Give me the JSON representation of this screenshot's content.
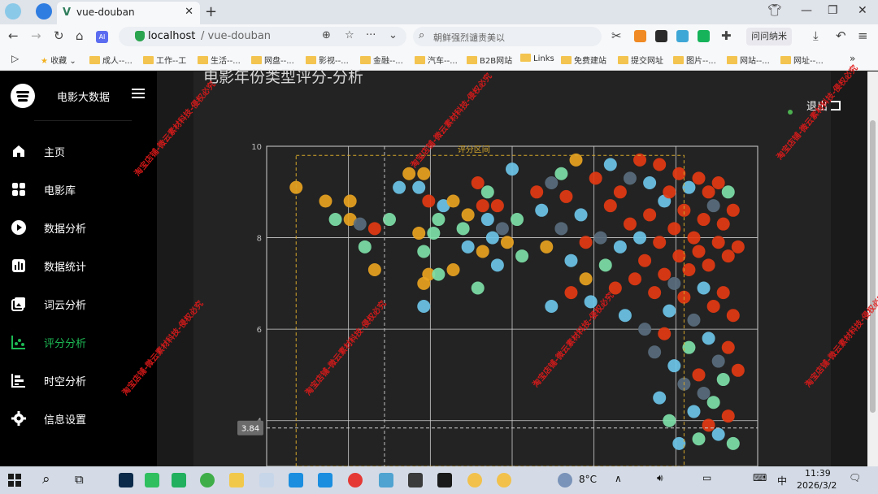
{
  "browser": {
    "tab_title": "vue-douban",
    "url_host": "localhost",
    "url_path": "/ vue-douban",
    "search_placeholder": "朝鲜强烈谴责美以",
    "ext_label": "问问纳米",
    "bookmarks": [
      "收藏",
      "成人--...",
      "工作--工",
      "生活--...",
      "网盘--...",
      "影视--...",
      "金融--...",
      "汽车--...",
      "B2B网站",
      "Links",
      "免费建站",
      "提交网址",
      "图片--...",
      "网站--...",
      "网址--..."
    ]
  },
  "app": {
    "brand": "电影大数据",
    "menu": [
      {
        "label": "主页",
        "icon": "home-icon"
      },
      {
        "label": "电影库",
        "icon": "grid-icon"
      },
      {
        "label": "数据分析",
        "icon": "play-circle-icon"
      },
      {
        "label": "数据统计",
        "icon": "bar-chart-icon"
      },
      {
        "label": "词云分析",
        "icon": "image-icon"
      },
      {
        "label": "评分分析",
        "icon": "scatter-icon",
        "active": true
      },
      {
        "label": "时空分析",
        "icon": "timeline-icon"
      },
      {
        "label": "信息设置",
        "icon": "gear-icon"
      }
    ],
    "page_title": "电影年份类型评分-分析",
    "logout": "退出",
    "accent": "#1db954"
  },
  "chart_data": {
    "type": "scatter",
    "ylim": [
      3,
      10
    ],
    "yticks": [
      "10",
      "8",
      "6",
      "4"
    ],
    "markarea_label": "评分区间",
    "markline_value": "3.84",
    "series_colors": [
      "#e8a321",
      "#6cc4e8",
      "#7ee0a8",
      "#f1a630",
      "#5a6e7e",
      "#e33a12"
    ],
    "points": [
      [
        0.06,
        9.1,
        0
      ],
      [
        0.12,
        8.8,
        0
      ],
      [
        0.17,
        8.8,
        0
      ],
      [
        0.14,
        8.4,
        2
      ],
      [
        0.17,
        8.4,
        0
      ],
      [
        0.19,
        8.3,
        4
      ],
      [
        0.22,
        8.2,
        5
      ],
      [
        0.25,
        8.4,
        2
      ],
      [
        0.2,
        7.8,
        2
      ],
      [
        0.22,
        7.3,
        0
      ],
      [
        0.27,
        9.1,
        1
      ],
      [
        0.29,
        9.4,
        0
      ],
      [
        0.31,
        9.1,
        1
      ],
      [
        0.32,
        9.4,
        0
      ],
      [
        0.33,
        8.8,
        5
      ],
      [
        0.34,
        8.1,
        2
      ],
      [
        0.35,
        8.4,
        2
      ],
      [
        0.31,
        8.1,
        0
      ],
      [
        0.32,
        7.7,
        2
      ],
      [
        0.33,
        7.2,
        0
      ],
      [
        0.32,
        7.0,
        0
      ],
      [
        0.35,
        7.2,
        2
      ],
      [
        0.36,
        8.7,
        1
      ],
      [
        0.38,
        8.8,
        0
      ],
      [
        0.38,
        7.3,
        0
      ],
      [
        0.32,
        6.5,
        1
      ],
      [
        0.4,
        8.2,
        2
      ],
      [
        0.41,
        8.5,
        0
      ],
      [
        0.41,
        7.8,
        1
      ],
      [
        0.43,
        9.2,
        5
      ],
      [
        0.44,
        8.7,
        5
      ],
      [
        0.45,
        8.4,
        1
      ],
      [
        0.47,
        8.7,
        5
      ],
      [
        0.45,
        9.0,
        2
      ],
      [
        0.44,
        7.7,
        0
      ],
      [
        0.46,
        8.0,
        1
      ],
      [
        0.47,
        7.4,
        1
      ],
      [
        0.48,
        8.2,
        4
      ],
      [
        0.49,
        7.9,
        0
      ],
      [
        0.5,
        9.5,
        1
      ],
      [
        0.51,
        8.4,
        2
      ],
      [
        0.52,
        7.6,
        2
      ],
      [
        0.43,
        6.9,
        2
      ],
      [
        0.55,
        9.0,
        5
      ],
      [
        0.56,
        8.6,
        1
      ],
      [
        0.58,
        9.2,
        4
      ],
      [
        0.57,
        7.8,
        0
      ],
      [
        0.58,
        6.5,
        1
      ],
      [
        0.6,
        9.4,
        2
      ],
      [
        0.61,
        8.9,
        5
      ],
      [
        0.6,
        8.2,
        4
      ],
      [
        0.62,
        7.5,
        1
      ],
      [
        0.62,
        6.8,
        5
      ],
      [
        0.63,
        9.7,
        0
      ],
      [
        0.64,
        8.5,
        1
      ],
      [
        0.65,
        7.9,
        5
      ],
      [
        0.65,
        7.1,
        0
      ],
      [
        0.66,
        6.6,
        1
      ],
      [
        0.67,
        9.3,
        5
      ],
      [
        0.68,
        8.0,
        4
      ],
      [
        0.69,
        7.4,
        2
      ],
      [
        0.7,
        9.6,
        1
      ],
      [
        0.7,
        8.7,
        5
      ],
      [
        0.71,
        6.9,
        5
      ],
      [
        0.72,
        9.0,
        5
      ],
      [
        0.72,
        7.8,
        1
      ],
      [
        0.73,
        6.3,
        1
      ],
      [
        0.74,
        9.3,
        4
      ],
      [
        0.74,
        8.3,
        5
      ],
      [
        0.75,
        7.1,
        5
      ],
      [
        0.76,
        9.7,
        5
      ],
      [
        0.76,
        8.0,
        1
      ],
      [
        0.77,
        6.0,
        4
      ],
      [
        0.77,
        7.5,
        5
      ],
      [
        0.78,
        9.2,
        1
      ],
      [
        0.78,
        8.5,
        5
      ],
      [
        0.79,
        6.8,
        5
      ],
      [
        0.79,
        5.5,
        4
      ],
      [
        0.8,
        9.6,
        5
      ],
      [
        0.8,
        7.9,
        5
      ],
      [
        0.8,
        4.5,
        1
      ],
      [
        0.81,
        8.8,
        1
      ],
      [
        0.81,
        7.2,
        5
      ],
      [
        0.81,
        5.9,
        5
      ],
      [
        0.82,
        9.0,
        5
      ],
      [
        0.82,
        6.4,
        1
      ],
      [
        0.82,
        4.0,
        2
      ],
      [
        0.83,
        8.2,
        5
      ],
      [
        0.83,
        7.0,
        4
      ],
      [
        0.83,
        5.2,
        1
      ],
      [
        0.84,
        9.4,
        5
      ],
      [
        0.84,
        7.6,
        5
      ],
      [
        0.84,
        3.5,
        1
      ],
      [
        0.85,
        8.6,
        5
      ],
      [
        0.85,
        6.7,
        5
      ],
      [
        0.85,
        4.8,
        4
      ],
      [
        0.86,
        9.1,
        1
      ],
      [
        0.86,
        7.3,
        5
      ],
      [
        0.86,
        5.6,
        2
      ],
      [
        0.87,
        8.0,
        5
      ],
      [
        0.87,
        6.2,
        4
      ],
      [
        0.87,
        4.2,
        1
      ],
      [
        0.88,
        9.3,
        5
      ],
      [
        0.88,
        7.7,
        5
      ],
      [
        0.88,
        5.0,
        5
      ],
      [
        0.88,
        3.6,
        2
      ],
      [
        0.89,
        8.4,
        5
      ],
      [
        0.89,
        6.9,
        1
      ],
      [
        0.89,
        4.6,
        4
      ],
      [
        0.9,
        9.0,
        5
      ],
      [
        0.9,
        7.4,
        5
      ],
      [
        0.9,
        5.8,
        1
      ],
      [
        0.9,
        3.9,
        5
      ],
      [
        0.91,
        8.7,
        4
      ],
      [
        0.91,
        6.5,
        5
      ],
      [
        0.91,
        4.4,
        2
      ],
      [
        0.92,
        9.2,
        5
      ],
      [
        0.92,
        7.9,
        5
      ],
      [
        0.92,
        5.3,
        4
      ],
      [
        0.92,
        3.7,
        1
      ],
      [
        0.93,
        8.3,
        5
      ],
      [
        0.93,
        6.8,
        5
      ],
      [
        0.93,
        4.9,
        2
      ],
      [
        0.94,
        9.0,
        2
      ],
      [
        0.94,
        7.6,
        5
      ],
      [
        0.94,
        5.6,
        5
      ],
      [
        0.94,
        4.1,
        5
      ],
      [
        0.95,
        8.6,
        5
      ],
      [
        0.95,
        6.3,
        5
      ],
      [
        0.95,
        3.5,
        2
      ],
      [
        0.96,
        7.8,
        5
      ],
      [
        0.96,
        5.1,
        5
      ]
    ]
  },
  "taskbar": {
    "weather": "8°C",
    "ime": "中",
    "time": "11:39",
    "date": "2026/3/2"
  },
  "watermark": "淘宝店铺-微云素材科技-侵权必究"
}
